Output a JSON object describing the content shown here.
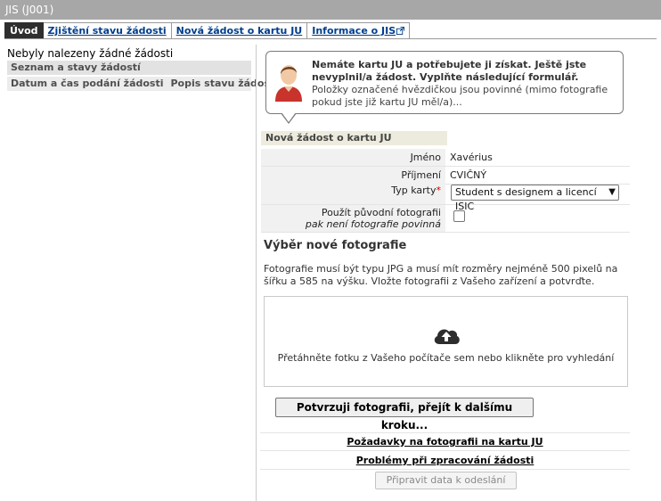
{
  "window": {
    "title": "JIS (J001)"
  },
  "tabs": [
    {
      "label": "Úvod",
      "active": true
    },
    {
      "label": "Zjištění stavu žádosti",
      "active": false
    },
    {
      "label": "Nová žádost o kartu JU",
      "active": false
    },
    {
      "label": "Informace o JIS",
      "active": false,
      "icon": "external-link-icon"
    }
  ],
  "left_pane": {
    "no_results": "Nebyly nalezeny žádné žádosti",
    "section_title": "Seznam a stavy žádostí",
    "columns": [
      "Datum a čas podání žádosti",
      "Popis stavu žádosti"
    ]
  },
  "notice": {
    "icon": "user-avatar-icon",
    "bold_text": "Nemáte kartu JU a potřebujete ji získat. Ještě jste nevyplnil/a žádost. Vyplňte následující formulář.",
    "normal_text": " Položky označené hvězdičkou jsou povinné (mimo fotografie pokud jste již kartu JU měl/a)..."
  },
  "form": {
    "header": "Nová žádost o kartu JU",
    "first_name_label": "Jméno",
    "first_name_value": "Xavérius",
    "last_name_label": "Příjmení",
    "last_name_value": "CVIČNÝ",
    "card_type_label": "Typ karty",
    "required_mark": "*",
    "card_type_value": "Student s designem a licencí ISIC",
    "use_original_photo_label": "Použít původní fotografii",
    "use_original_photo_note": "pak není fotografie povinná",
    "use_original_photo_checked": false
  },
  "photo": {
    "title": "Výběr nové fotografie",
    "description": "Fotografie musí být typu JPG a musí mít rozměry nejméně 500 pixelů na šířku a 585 na výšku. Vložte fotografii z Vašeho zařízení a potvrďte.",
    "dropzone_icon": "cloud-upload-icon",
    "dropzone_text": "Přetáhněte fotku z Vašeho počítače sem nebo klikněte pro vyhledání",
    "confirm_button": "Potvrzuji fotografii, přejít k dalšímu kroku..."
  },
  "links": {
    "photo_requirements": "Požadavky na fotografii na kartu JU",
    "processing_problems": "Problémy při zpracování žádosti"
  },
  "prepare_button": "Připravit data k odeslání",
  "colors": {
    "title_bar": "#a7a7a7",
    "active_tab": "#2e2e2e",
    "link": "#003e8c",
    "required": "#cc0000"
  }
}
